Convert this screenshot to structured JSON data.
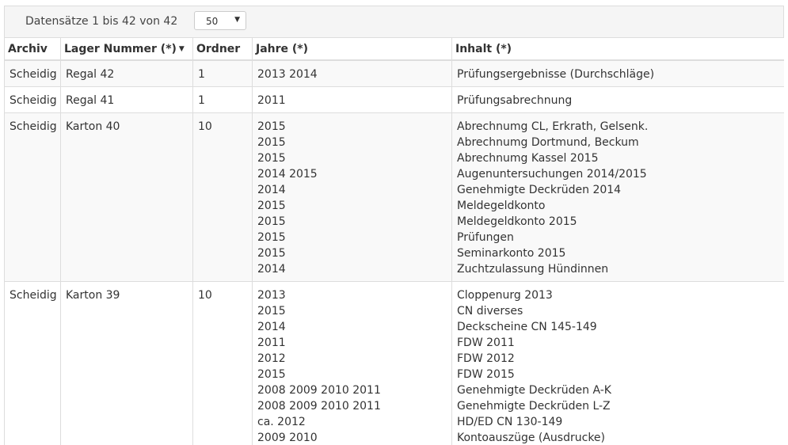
{
  "toolbar": {
    "records_info": "Datensätze 1 bis 42 von 42",
    "page_size": "50"
  },
  "columns": {
    "archiv": "Archiv",
    "lager": "Lager Nummer (*)",
    "ordner": "Ordner",
    "jahre": "Jahre (*)",
    "inhalt": "Inhalt (*)"
  },
  "rows": [
    {
      "archiv": "Scheidig",
      "lager": "Regal 42",
      "ordner": "1",
      "jahre": [
        "2013 2014"
      ],
      "inhalt": [
        "Prüfungsergebnisse (Durchschläge)"
      ]
    },
    {
      "archiv": "Scheidig",
      "lager": "Regal 41",
      "ordner": "1",
      "jahre": [
        "2011"
      ],
      "inhalt": [
        "Prüfungsabrechnung"
      ]
    },
    {
      "archiv": "Scheidig",
      "lager": "Karton 40",
      "ordner": "10",
      "jahre": [
        "2015",
        "2015",
        "2015",
        "2014 2015",
        "2014",
        "2015",
        "2015",
        "2015",
        "2015",
        "2014"
      ],
      "inhalt": [
        "Abrechnumg CL, Erkrath, Gelsenk.",
        "Abrechnumg Dortmund, Beckum",
        "Abrechnumg Kassel 2015",
        "Augenuntersuchungen 2014/2015",
        "Genehmigte Deckrüden 2014",
        "Meldegeldkonto",
        "Meldegeldkonto 2015",
        "Prüfungen",
        "Seminarkonto 2015",
        "Zuchtzulassung Hündinnen"
      ]
    },
    {
      "archiv": "Scheidig",
      "lager": "Karton 39",
      "ordner": "10",
      "jahre": [
        "2013",
        "2015",
        "2014",
        "2011",
        "2012",
        "2015",
        "2008 2009 2010 2011",
        "2008 2009 2010 2011",
        "ca. 2012",
        "2009 2010"
      ],
      "inhalt": [
        "Cloppenurg 2013",
        "CN diverses",
        "Deckscheine CN 145-149",
        "FDW 2011",
        "FDW 2012",
        "FDW 2015",
        "Genehmigte Deckrüden A-K",
        "Genehmigte Deckrüden L-Z",
        "HD/ED CN 130-149",
        "Kontoauszüge (Ausdrucke)"
      ]
    }
  ]
}
